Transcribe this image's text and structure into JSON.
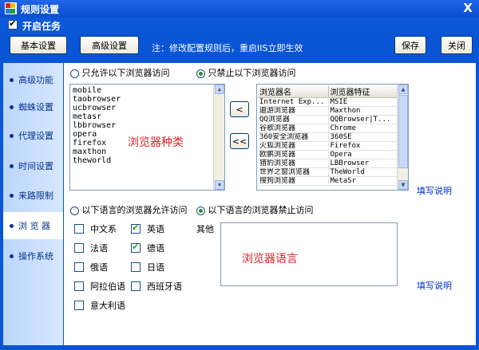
{
  "window": {
    "title": "规则设置",
    "close": "X"
  },
  "topbar": {
    "enable_label": "开启任务",
    "enabled": true
  },
  "toolbar": {
    "basic_label": "基本设置",
    "advanced_label": "高级设置",
    "note": "注：修改配置规则后，重启IIS立即生效",
    "save_label": "保存",
    "close_label": "关闭"
  },
  "sidebar": {
    "items": [
      {
        "label": "高级功能",
        "active": false
      },
      {
        "label": "蜘蛛设置",
        "active": false
      },
      {
        "label": "代理设置",
        "active": false
      },
      {
        "label": "时间设置",
        "active": false
      },
      {
        "label": "来路限制",
        "active": false
      },
      {
        "label": "浏 览 器",
        "active": true
      },
      {
        "label": "操作系统",
        "active": false
      }
    ]
  },
  "browser": {
    "allow_label": "只允许以下浏览器访问",
    "deny_label": "只禁止以下浏览器访问",
    "selected_mode": "deny",
    "list": [
      "mobile",
      "taobrowser",
      "ucbrowser",
      "metasr",
      "lbbrowser",
      "opera",
      "firefox",
      "maxthon",
      "theworld"
    ],
    "list_watermark": "浏览器种类",
    "btn_add": "<",
    "btn_add_all": "<<",
    "table": {
      "headers": [
        "浏览器名",
        "浏览器特征"
      ],
      "rows": [
        [
          "Internet Exp...",
          "MSIE"
        ],
        [
          "遨游浏览器",
          "Maxthon"
        ],
        [
          "QQ浏览器",
          "QQBrowser|T..."
        ],
        [
          "谷歌浏览器",
          "Chrome"
        ],
        [
          "360安全浏览器",
          "360SE"
        ],
        [
          "火狐浏览器",
          "Firefox"
        ],
        [
          "欧鹏浏览器",
          "Opera"
        ],
        [
          "猎豹浏览器",
          "LBBrowser"
        ],
        [
          "世界之窗浏览器",
          "TheWorld"
        ],
        [
          "搜狗浏览器",
          "MetaSr"
        ]
      ]
    },
    "help_link": "填写说明"
  },
  "language": {
    "allow_label": "以下语言的浏览器允许访问",
    "deny_label": "以下语言的浏览器禁止访问",
    "selected_mode": "deny",
    "items": [
      {
        "label": "中文系",
        "checked": false
      },
      {
        "label": "英语",
        "checked": true
      },
      {
        "label": "法语",
        "checked": false
      },
      {
        "label": "德语",
        "checked": true
      },
      {
        "label": "俄语",
        "checked": false
      },
      {
        "label": "日语",
        "checked": false
      },
      {
        "label": "阿拉伯语",
        "checked": false
      },
      {
        "label": "西班牙语",
        "checked": false
      },
      {
        "label": "意大利语",
        "checked": false
      }
    ],
    "other_label": "其他",
    "other_watermark": "浏览器语言",
    "help_link": "填写说明"
  }
}
